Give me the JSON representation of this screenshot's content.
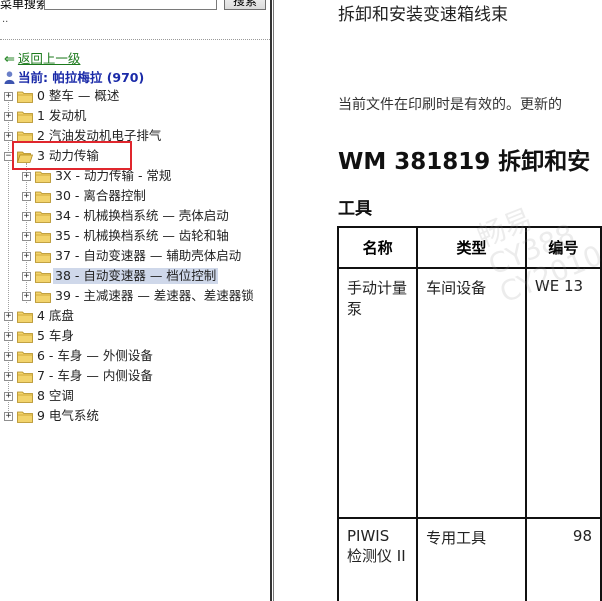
{
  "search": {
    "label": "菜单搜索",
    "value": "",
    "button": "搜索"
  },
  "nav": {
    "dots": "..",
    "back_label": "返回上一级",
    "current_label": "当前: 帕拉梅拉 (970)"
  },
  "tree": {
    "items": [
      {
        "label": "0 整车 — 概述"
      },
      {
        "label": "1 发动机"
      },
      {
        "label": "2 汽油发动机电子排气"
      },
      {
        "label": "3 动力传输"
      },
      {
        "label": "3X - 动力传输 - 常规"
      },
      {
        "label": "30 - 离合器控制"
      },
      {
        "label": "34 - 机械换档系统 — 壳体启动"
      },
      {
        "label": "35 - 机械换档系统 — 齿轮和轴"
      },
      {
        "label": "37 - 自动变速器 — 辅助壳体启动"
      },
      {
        "label": "38 - 自动变速器 — 档位控制"
      },
      {
        "label": "39 - 主减速器 — 差速器、差速器锁"
      },
      {
        "label": "4 底盘"
      },
      {
        "label": "5 车身"
      },
      {
        "label": "6 - 车身 — 外侧设备"
      },
      {
        "label": "7 - 车身 — 内侧设备"
      },
      {
        "label": "8 空调"
      },
      {
        "label": "9 电气系统"
      }
    ]
  },
  "doc": {
    "heading": "拆卸和安装变速箱线束",
    "note": "当前文件在印刷时是有效的。更新的",
    "title": "WM 381819 拆卸和安",
    "tools_heading": "工具",
    "watermark": "畅易 CY388 CY2010",
    "table": {
      "headers": [
        "名称",
        "类型",
        "编号"
      ],
      "rows": [
        [
          "手动计量泵",
          "车间设备",
          "WE 13"
        ],
        [
          "PIWIS 检测仪 II",
          "专用工具",
          "98"
        ]
      ]
    }
  },
  "colors": {
    "highlight_box": "#e0262d",
    "folder": "#f2d36b",
    "current_text": "#1a2aa8",
    "back_link": "#1c7a1c",
    "selected_bg": "#cfd8ea"
  }
}
